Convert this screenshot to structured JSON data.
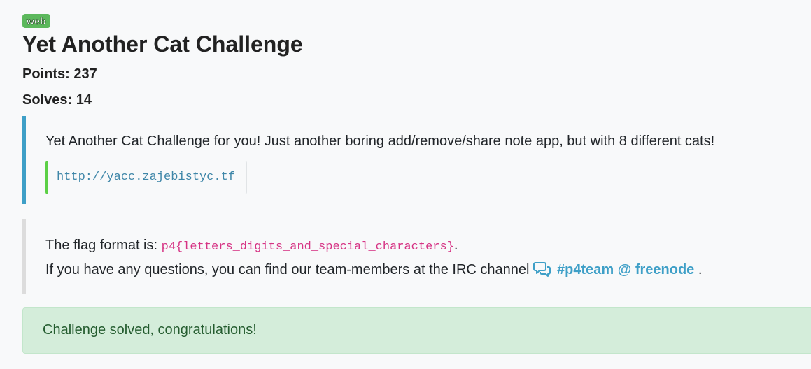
{
  "challenge": {
    "category_badge": "web",
    "title": "Yet Another Cat Challenge",
    "points_label": "Points: 237",
    "solves_label": "Solves: 14",
    "description": "Yet Another Cat Challenge for you! Just another boring add/remove/share note app, but with 8 different cats!",
    "url": "http://yacc.zajebistyc.tf"
  },
  "info": {
    "flag_prefix": "The flag format is: ",
    "flag_format": "p4{letters_digits_and_special_characters}",
    "flag_suffix": ".",
    "question_text": "If you have any questions, you can find our team-members at the IRC channel",
    "irc_icon": "comments-icon",
    "irc_link": "#p4team @ freenode",
    "question_suffix": "."
  },
  "status": {
    "message": "Challenge solved, congratulations!"
  },
  "colors": {
    "badge": "#5cb85c",
    "accent_blue": "#3e9fc7",
    "url_border": "#5cd046",
    "flag_pink": "#d63384",
    "success_bg": "#d4edda"
  }
}
